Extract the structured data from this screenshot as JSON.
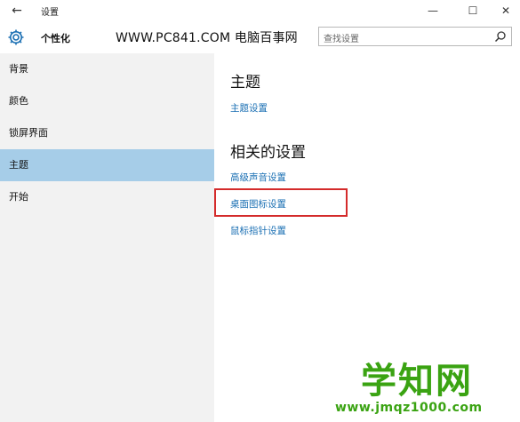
{
  "titlebar": {
    "back_symbol": "←",
    "title": "设置",
    "minimize_symbol": "—",
    "maximize_symbol": "☐",
    "close_symbol": "✕"
  },
  "header": {
    "section_name": "个性化",
    "gear_icon": "gear-icon",
    "watermark_text": "WWW.PC841.COM 电脑百事网",
    "search": {
      "placeholder": "查找设置",
      "icon": "search-icon"
    }
  },
  "sidebar": {
    "items": [
      {
        "label": "背景",
        "active": false
      },
      {
        "label": "颜色",
        "active": false
      },
      {
        "label": "锁屏界面",
        "active": false
      },
      {
        "label": "主题",
        "active": true
      },
      {
        "label": "开始",
        "active": false
      }
    ]
  },
  "main": {
    "theme_heading": "主题",
    "theme_link": "主题设置",
    "related_heading": "相关的设置",
    "related_links": [
      "高级声音设置",
      "桌面图标设置",
      "鼠标指针设置"
    ]
  },
  "watermark": {
    "logo": "学知网",
    "url": "www.jmqz1000.com"
  },
  "colors": {
    "accent": "#1a6fb3",
    "active_nav": "#a6cde8",
    "highlight": "#d42b2b",
    "brand": "#3aa312"
  }
}
